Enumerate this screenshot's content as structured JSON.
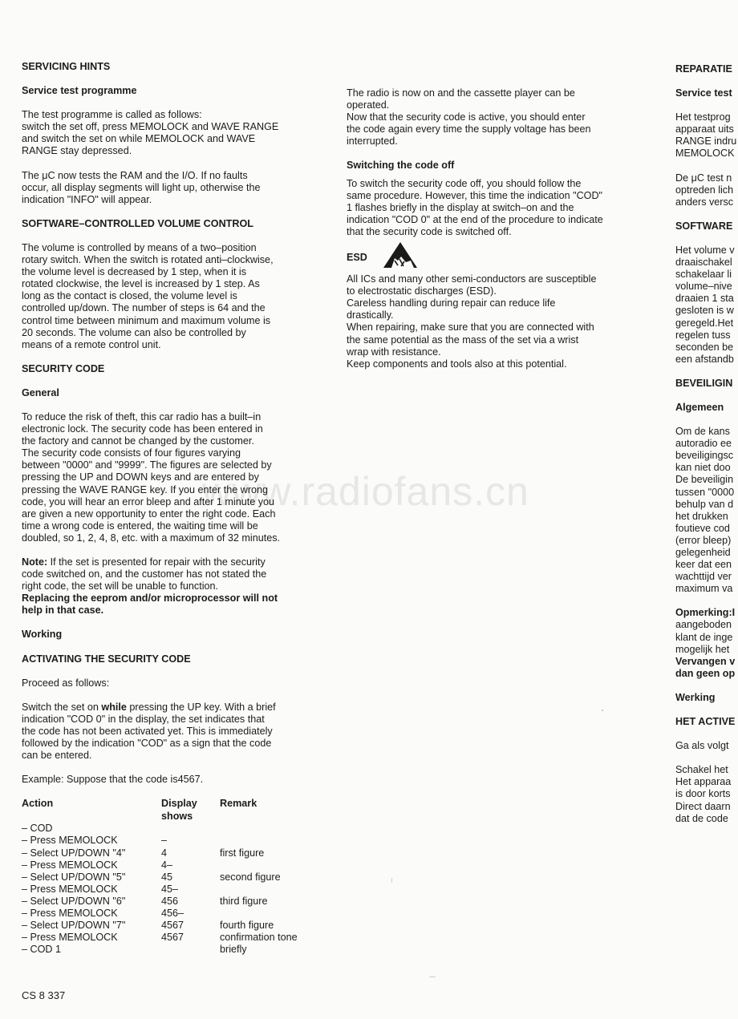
{
  "left_column": {
    "title": "SERVICING HINTS",
    "service_test": {
      "heading": "Service test programme",
      "para1": [
        "The test programme is called as follows:",
        "switch the set off, press MEMOLOCK and WAVE RANGE",
        "and switch the set on while MEMOLOCK and WAVE",
        "RANGE stay depressed."
      ],
      "para2": [
        "The μC now tests the RAM and the I/O. If no faults",
        "occur, all display segments will light up, otherwise the",
        "indication \"INFO\" will appear."
      ]
    },
    "volume": {
      "heading": "SOFTWARE–CONTROLLED VOLUME CONTROL",
      "para": [
        "The volume is controlled by means of a two–position",
        "rotary switch. When the switch is rotated anti–clockwise,",
        "the volume level is decreased by 1 step, when it is",
        "rotated clockwise, the level is increased by 1 step. As",
        "long as the contact is closed, the volume level is",
        "controlled up/down. The number of steps is 64 and the",
        "control time between minimum and maximum volume is",
        "20 seconds. The volume can also be controlled by",
        "means of a remote control unit."
      ]
    },
    "security": {
      "heading": "SECURITY CODE",
      "general_heading": "General",
      "general_para": [
        "To reduce the risk of theft, this car radio has a built–in",
        "electronic lock. The security code has been entered in",
        "the factory and cannot be changed by the customer.",
        "The security code consists of four figures varying",
        "between \"0000\" and \"9999\". The figures are selected by",
        "pressing the UP and DOWN keys and are entered by",
        "pressing the WAVE RANGE key. If you enter the wrong",
        "code, you will hear an error bleep and after 1 minute you",
        "are given a new opportunity to enter the right code. Each",
        "time a wrong code is entered, the waiting time will be",
        "doubled, so 1, 2, 4, 8, etc. with a maximum of 32 minutes."
      ],
      "note_label": "Note:",
      "note_lines": [
        " If the set is presented for repair with the security",
        "code switched on, and the customer has not stated the",
        "right code, the set will be unable to function."
      ],
      "note_bold_lines": [
        "Replacing the eeprom and/or microprocessor will not",
        "help in that case."
      ],
      "working_heading": "Working",
      "activating_heading": "ACTIVATING THE SECURITY CODE",
      "proceed": "Proceed as follows:",
      "switch_on_pre": "Switch the set on ",
      "switch_on_bold": "while",
      "switch_on_post": " pressing the UP key. With a brief",
      "switch_on_rest": [
        "indication \"COD 0\" in the display, the set indicates that",
        "the code has not been activated yet. This is immediately",
        "followed by the indication \"COD\" as a sign that the code",
        "can be entered."
      ],
      "example": "Example: Suppose that the code is4567."
    },
    "table": {
      "headers": {
        "action": "Action",
        "display": "Display shows",
        "remark": "Remark"
      },
      "rows": [
        {
          "action": "– COD",
          "display": "",
          "remark": ""
        },
        {
          "action": "– Press MEMOLOCK",
          "display": "–",
          "remark": ""
        },
        {
          "action": "– Select UP/DOWN \"4\"",
          "display": "4",
          "remark": "first figure"
        },
        {
          "action": "– Press MEMOLOCK",
          "display": "4–",
          "remark": ""
        },
        {
          "action": "– Select UP/DOWN \"5\"",
          "display": "45",
          "remark": "second figure"
        },
        {
          "action": "– Press MEMOLOCK",
          "display": "45–",
          "remark": ""
        },
        {
          "action": "– Select UP/DOWN \"6\"",
          "display": "456",
          "remark": "third figure"
        },
        {
          "action": "– Press MEMOLOCK",
          "display": "456–",
          "remark": ""
        },
        {
          "action": "– Select UP/DOWN \"7\"",
          "display": "4567",
          "remark": "fourth figure"
        },
        {
          "action": "– Press MEMOLOCK",
          "display": "4567",
          "remark": "confirmation tone"
        },
        {
          "action": "– COD 1",
          "display": "",
          "remark": "briefly"
        }
      ]
    }
  },
  "middle_column": {
    "radio_on": [
      "The radio is now on and the cassette player can be",
      "operated.",
      "Now that the security code is active, you should enter",
      "the code again every time the supply voltage has been",
      "interrupted."
    ],
    "switching_off_heading": "Switching the code off",
    "switching_off_para": [
      "To switch the security code off, you should follow the",
      "same procedure. However, this time the indication \"COD\"",
      "1 flashes briefly in the display at switch–on and the",
      "indication \"COD 0\" at the end of the procedure to indicate",
      "that the security code is switched off."
    ],
    "esd_heading": "ESD",
    "esd_icon": "esd-warning-icon",
    "esd_para": [
      "All ICs and many other semi-conductors are susceptible",
      "to electrostatic discharges (ESD).",
      "Careless handling during repair can reduce life",
      "drastically.",
      "When repairing, make sure that you are connected with",
      "the same potential as the mass of the set via a wrist",
      "wrap with resistance.",
      "Keep components and tools also at this potential."
    ]
  },
  "right_column": {
    "title": "REPARATIE",
    "service_heading": "Service test",
    "para1": [
      "Het testprog",
      "apparaat uits",
      "RANGE indru",
      "MEMOLOCK"
    ],
    "para2": [
      "De μC test n",
      "optreden lich",
      "anders versc"
    ],
    "software_heading": "SOFTWARE",
    "volume_para": [
      "Het volume v",
      "draaischakel",
      "schakelaar li",
      "volume–nive",
      "draaien 1 sta",
      "gesloten is w",
      "geregeld.Het",
      "regelen tuss",
      "seconden be",
      "een afstandb"
    ],
    "beveiliging_heading": "BEVEILIGIN",
    "algemeen_heading": "Algemeen",
    "algemeen_para": [
      "Om de kans",
      "autoradio ee",
      "beveiligingsc",
      "kan niet doo",
      "De beveiligin",
      "tussen \"0000",
      "behulp van d",
      "het drukken",
      "foutieve cod",
      "(error bleep)",
      "gelegenheid",
      "keer dat een",
      "wachttijd ver",
      "maximum va"
    ],
    "opmerking_bold": "Opmerking:I",
    "opmerking_lines": [
      "aangeboden",
      "klant de inge",
      "mogelijk het"
    ],
    "opmerking_bold_lines": [
      "Vervangen v",
      "dan geen op"
    ],
    "werking_heading": "Werking",
    "activeren_heading": "HET ACTIVE",
    "ga_als": "Ga als volgt",
    "schakel_para": [
      "Schakel het",
      "Het apparaa",
      "is door korts",
      "Direct daarn",
      "dat de code"
    ]
  },
  "footer": {
    "doc_code": "CS 8 337"
  },
  "watermark": "www.radiofans.cn"
}
